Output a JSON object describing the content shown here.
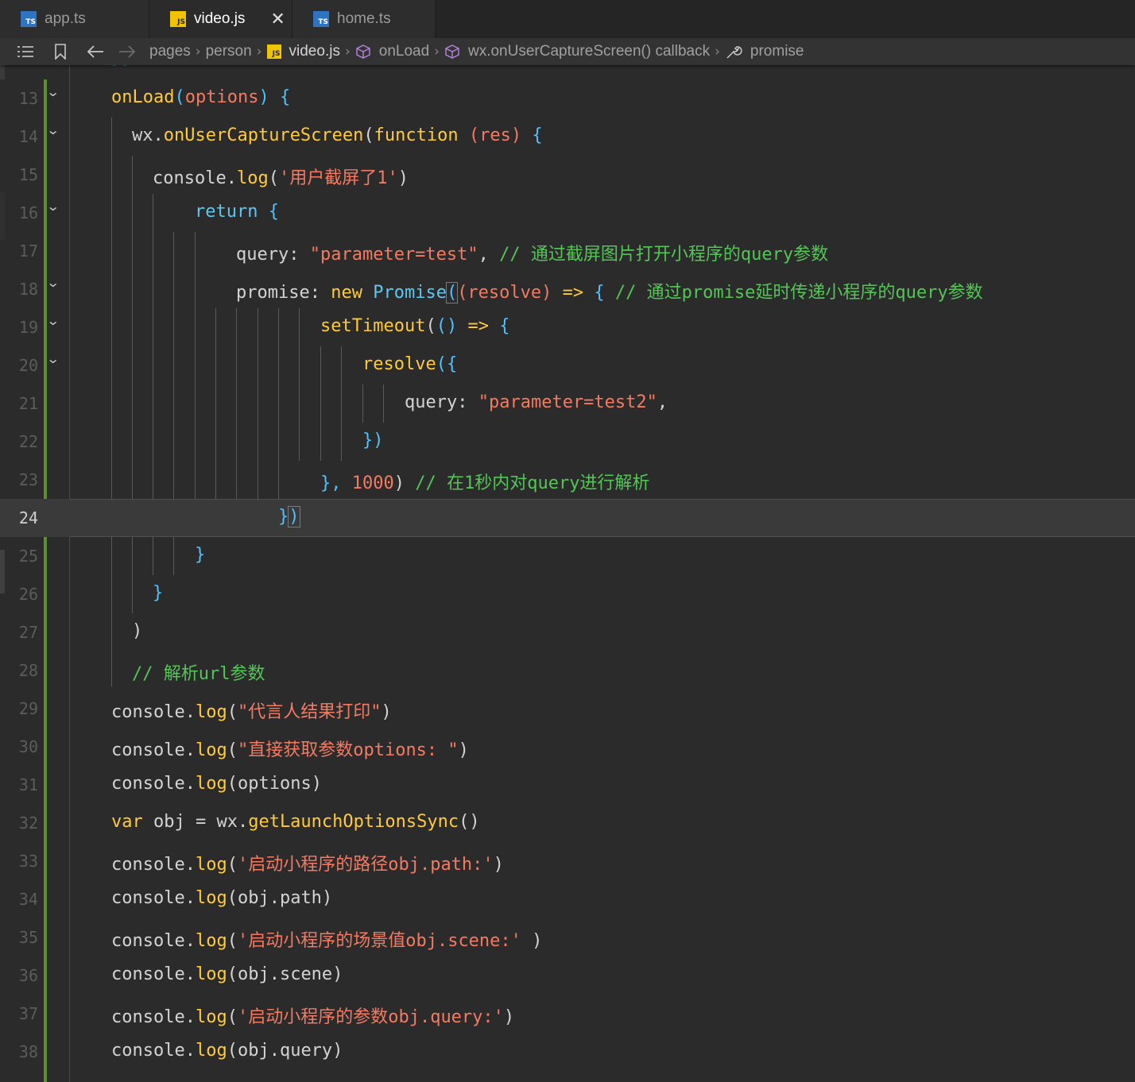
{
  "tabs": [
    {
      "label": "app.ts",
      "badge": "TS",
      "active": false
    },
    {
      "label": "video.js",
      "badge": "JS",
      "active": true
    },
    {
      "label": "home.ts",
      "badge": "TS",
      "active": false
    }
  ],
  "tab_close": "✕",
  "breadcrumb": {
    "segments": [
      "pages",
      "person",
      "video.js",
      "onLoad",
      "wx.onUserCaptureScreen() callback",
      "promise"
    ]
  },
  "editor": {
    "current_line": "24",
    "line_numbers": [
      "13",
      "14",
      "15",
      "16",
      "17",
      "18",
      "19",
      "20",
      "21",
      "22",
      "23",
      "24",
      "25",
      "26",
      "27",
      "28",
      "29",
      "30",
      "31",
      "32",
      "33",
      "34",
      "35",
      "36",
      "37",
      "38"
    ],
    "code": {
      "l13": {
        "fn": "onLoad",
        "p1": "(",
        "arg": "options",
        "p2": ")",
        "brace": " {"
      },
      "l14": {
        "obj": "wx.",
        "fn": "onUserCaptureScreen",
        "p1": "(",
        "kw": "function",
        "sp": " ",
        "arg": "(res)",
        "brace": " {"
      },
      "l15": {
        "obj": "console.",
        "fn": "log",
        "p1": "(",
        "str": "'用户截屏了1'",
        "p2": ")"
      },
      "l16": {
        "kw": "return",
        "brace": " {"
      },
      "l17": {
        "key": "query",
        "colon": ": ",
        "str": "\"parameter=test\"",
        "comma": ",",
        "cmt": " // 通过截屏图片打开小程序的query参数"
      },
      "l18": {
        "key": "promise",
        "colon": ": ",
        "kw": "new",
        "sp": " ",
        "cls": "Promise",
        "p1": "(",
        "arg": "(resolve)",
        "arrow": " => ",
        "brace": "{",
        "cmt": " // 通过promise延时传递小程序的query参数"
      },
      "l19": {
        "fn": "setTimeout",
        "p1": "(",
        "args": "()",
        "arrow": " => ",
        "brace": "{"
      },
      "l20": {
        "fn": "resolve",
        "p1": "(",
        "brace": "{"
      },
      "l21": {
        "key": "query",
        "colon": ": ",
        "str": "\"parameter=test2\"",
        "comma": ","
      },
      "l22": {
        "close": "})"
      },
      "l23": {
        "close": "}, ",
        "num": "1000",
        "p2": ")",
        "cmt": " // 在1秒内对query进行解析"
      },
      "l24": {
        "brace": "}",
        "p2": ")"
      },
      "l25": {
        "brace": "}"
      },
      "l26": {
        "brace": "}"
      },
      "l27": {
        "p2": ")"
      },
      "l28": {
        "cmt": "// 解析url参数"
      },
      "l29": {
        "obj": "console.",
        "fn": "log",
        "p1": "(",
        "str": "\"代言人结果打印\"",
        "p2": ")"
      },
      "l30": {
        "obj": "console.",
        "fn": "log",
        "p1": "(",
        "str": "\"直接获取参数options: \"",
        "p2": ")"
      },
      "l31": {
        "obj": "console.",
        "fn": "log",
        "p1": "(",
        "arg": "options",
        "p2": ")"
      },
      "l32": {
        "kw": "var",
        "rest": " obj = wx.",
        "fn": "getLaunchOptionsSync",
        "p": "()"
      },
      "l33": {
        "obj": "console.",
        "fn": "log",
        "p1": "(",
        "str": "'启动小程序的路径obj.path:'",
        "p2": ")"
      },
      "l34": {
        "obj": "console.",
        "fn": "log",
        "p1": "(",
        "arg": "obj.path",
        "p2": ")"
      },
      "l35": {
        "obj": "console.",
        "fn": "log",
        "p1": "(",
        "str": "'启动小程序的场景值obj.scene:'",
        "p2": " )"
      },
      "l36": {
        "obj": "console.",
        "fn": "log",
        "p1": "(",
        "arg": "obj.scene",
        "p2": ")"
      },
      "l37": {
        "obj": "console.",
        "fn": "log",
        "p1": "(",
        "str": "'启动小程序的参数obj.query:'",
        "p2": ")"
      },
      "l38": {
        "obj": "console.",
        "fn": "log",
        "p1": "(",
        "arg": "obj.query",
        "p2": ")"
      }
    }
  }
}
